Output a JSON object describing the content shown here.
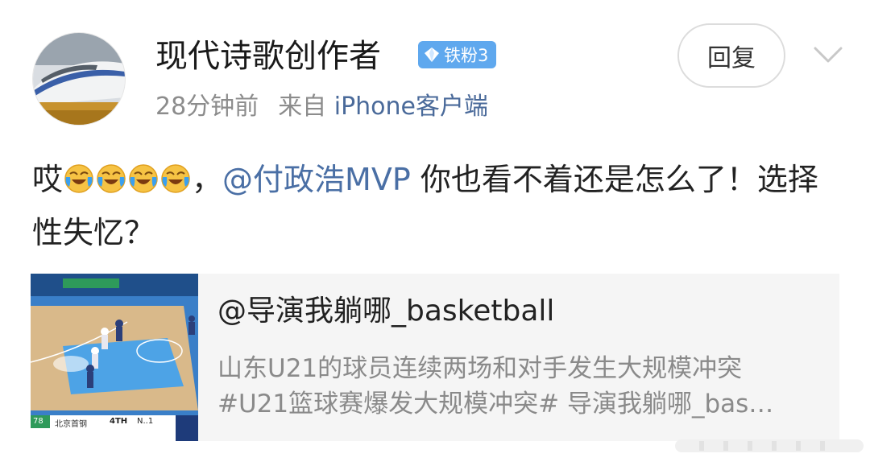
{
  "post": {
    "username": "现代诗歌创作者",
    "fan_badge": "铁粉3",
    "time": "28分钟前",
    "source_prefix": "来自",
    "source_app": "iPhone客户端",
    "reply_label": "回复",
    "text_prefix": "哎",
    "emoji_icons": [
      "laughing-crying-icon",
      "laughing-crying-icon",
      "laughing-crying-icon",
      "laughing-crying-icon"
    ],
    "comma": "，",
    "mention": "@付政浩MVP",
    "text_rest": " 你也看不着还是怎么了！选择性失忆？"
  },
  "card": {
    "title": "@导演我躺哪_basketball",
    "desc_line1": "山东U21的球员连续两场和对手发生大规模冲突",
    "desc_line2": "#U21篮球赛爆发大规模冲突# 导演我躺哪_bas…",
    "thumb": {
      "score_left": "78",
      "team_left": "北京首钢",
      "quarter": "4TH",
      "score_right": "N..1"
    }
  },
  "colors": {
    "link": "#4a6fa5",
    "badge": "#5fa8ee",
    "muted": "#8c8c8c"
  }
}
